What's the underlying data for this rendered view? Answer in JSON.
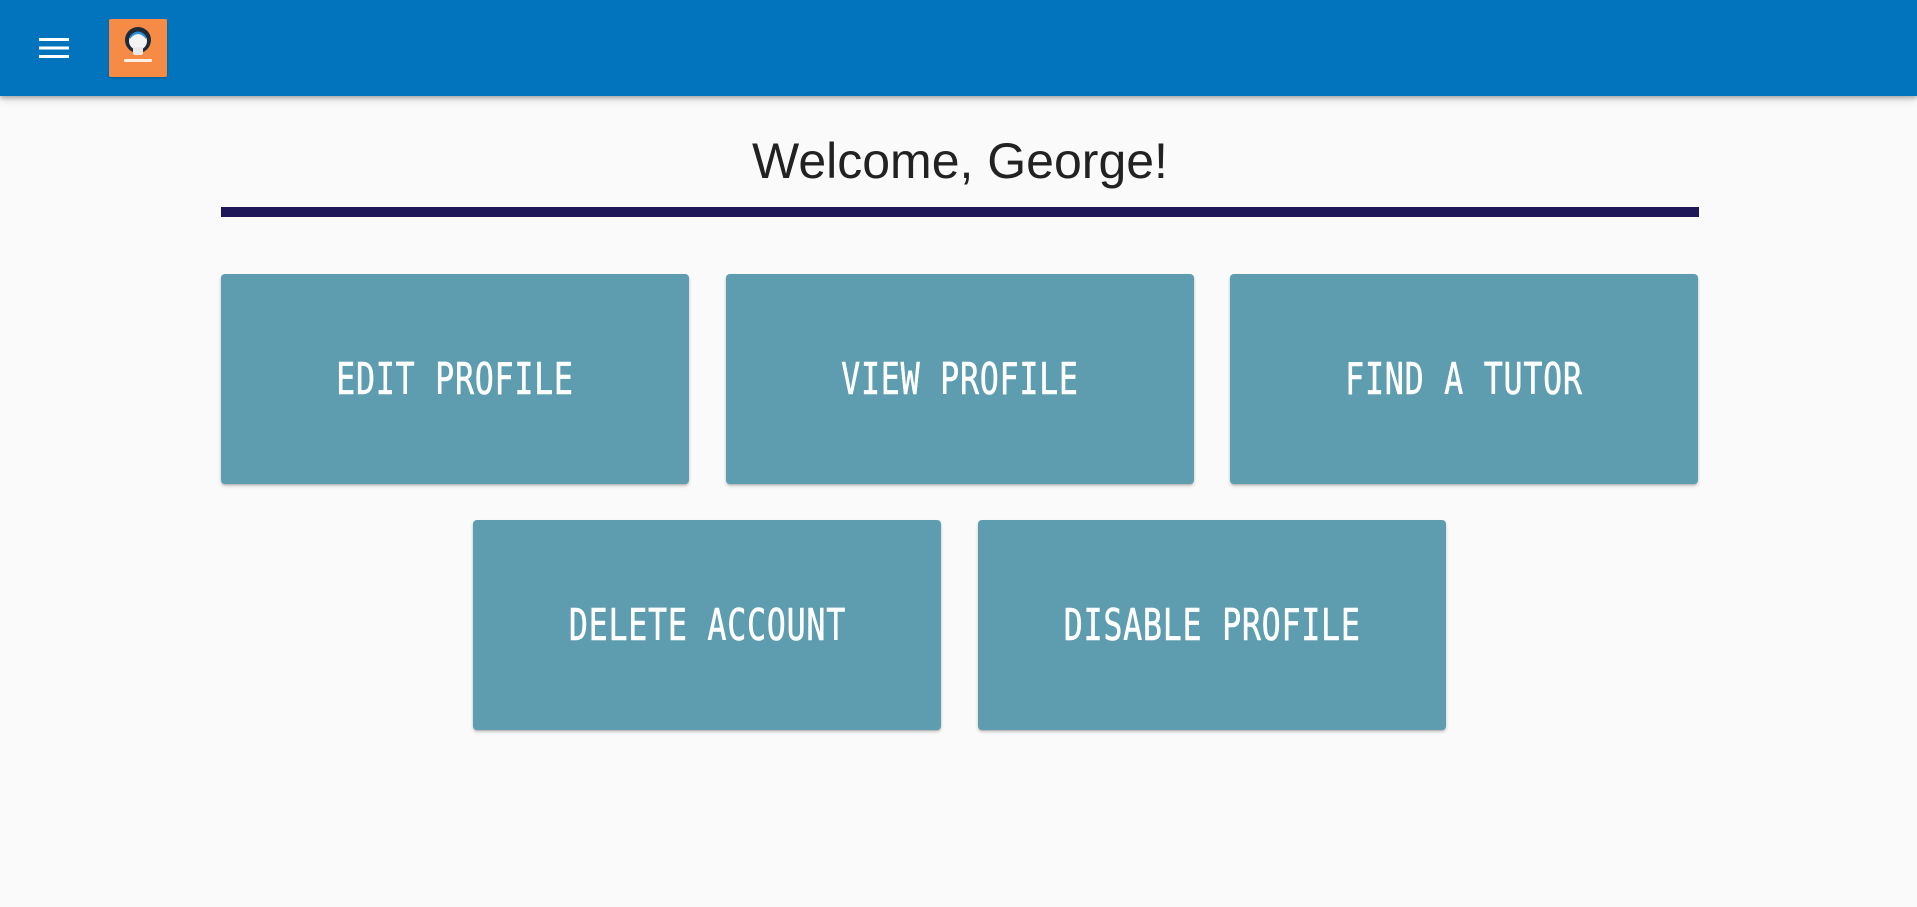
{
  "header": {
    "menu_icon": "hamburger-menu-icon",
    "logo_icon": "tutor-logo-icon",
    "colors": {
      "app_bar": "#0274bd",
      "logo_background": "#f68b45"
    }
  },
  "main": {
    "welcome_text": "Welcome, George!",
    "divider_color": "#1f1858",
    "tile_color": "#5e9caf",
    "actions": {
      "edit_profile": "EDIT PROFILE",
      "view_profile": "VIEW PROFILE",
      "find_tutor": "FIND A TUTOR",
      "delete_account": "DELETE ACCOUNT",
      "disable_profile": "DISABLE PROFILE"
    }
  }
}
